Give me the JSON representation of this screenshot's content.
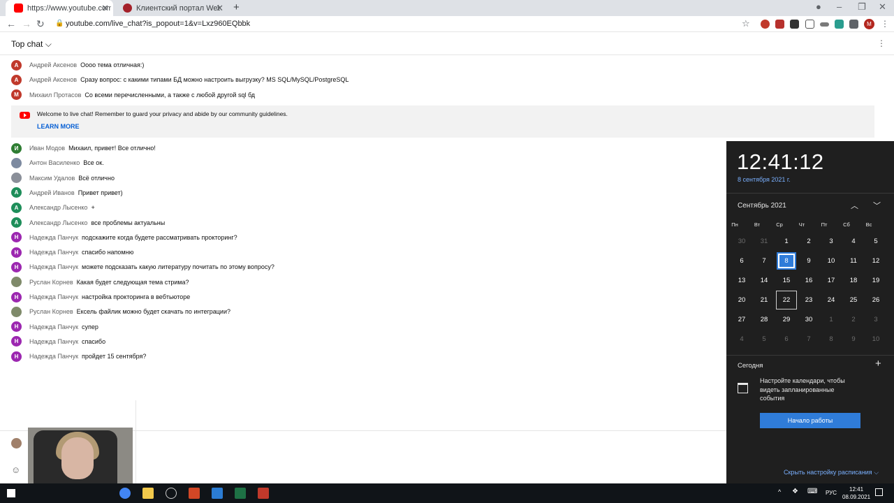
{
  "browser": {
    "tabs": [
      {
        "title": "https://www.youtube.com/live_ch",
        "active": true
      },
      {
        "title": "Клиентский портал WebSoft",
        "active": false
      }
    ],
    "url": "youtube.com/live_chat?is_popout=1&v=Lxz960EQbbk"
  },
  "chat": {
    "header": "Top chat",
    "messages_top": [
      {
        "initial": "А",
        "color": "#c0392b",
        "author": "Андрей Аксенов",
        "text": "Оооо тема отличная:)"
      },
      {
        "initial": "А",
        "color": "#c0392b",
        "author": "Андрей Аксенов",
        "text": "Сразу вопрос: с какими типами БД можно настроить выгрузку? MS SQL/MySQL/PostgreSQL"
      },
      {
        "initial": "М",
        "color": "#c0392b",
        "author": "Михаил Протасов",
        "text": "Со всеми перечисленными, а также с любой другой sql бд"
      }
    ],
    "notice": {
      "text": "Welcome to live chat! Remember to guard your privacy and abide by our community guidelines.",
      "link": "LEARN MORE"
    },
    "messages": [
      {
        "initial": "И",
        "color": "#2e7d32",
        "author": "Иван Модов",
        "text": "Михаил, привет! Все отлично!"
      },
      {
        "initial": "",
        "color": "#7d8aa0",
        "author": "Антон Василенко",
        "text": "Все ок."
      },
      {
        "initial": "",
        "color": "#8a8f99",
        "author": "Максим Удалов",
        "text": "Всё отлично"
      },
      {
        "initial": "А",
        "color": "#1e8e5a",
        "author": "Андрей Иванов",
        "text": "Привет привет)"
      },
      {
        "initial": "А",
        "color": "#1e8e5a",
        "author": "Александр Лысенко",
        "text": "+"
      },
      {
        "initial": "А",
        "color": "#1e8e5a",
        "author": "Александр Лысенко",
        "text": "все проблемы актуальны"
      },
      {
        "initial": "Н",
        "color": "#9c27b0",
        "author": "Надежда Панчук",
        "text": "подскажите когда будете рассматривать прокторинг?"
      },
      {
        "initial": "Н",
        "color": "#9c27b0",
        "author": "Надежда Панчук",
        "text": "спасибо напомню"
      },
      {
        "initial": "Н",
        "color": "#9c27b0",
        "author": "Надежда Панчук",
        "text": "можете подсказать какую литературу почитать по этому вопросу?"
      },
      {
        "initial": "",
        "color": "#7f8a6a",
        "author": "Руслан Корнев",
        "text": "Какая будет следующая тема стрима?"
      },
      {
        "initial": "Н",
        "color": "#9c27b0",
        "author": "Надежда Панчук",
        "text": "настройка прокторинга в вебтьюторе"
      },
      {
        "initial": "",
        "color": "#7f8a6a",
        "author": "Руслан Корнев",
        "text": "Ексель файлик можно будет скачать по интеграции?"
      },
      {
        "initial": "Н",
        "color": "#9c27b0",
        "author": "Надежда Панчук",
        "text": "супер"
      },
      {
        "initial": "Н",
        "color": "#9c27b0",
        "author": "Надежда Панчук",
        "text": "спасибо"
      },
      {
        "initial": "Н",
        "color": "#9c27b0",
        "author": "Надежда Панчук",
        "text": "пройдет 15 сентября?"
      }
    ]
  },
  "calendar": {
    "time": "12:41:12",
    "date": "8 сентября 2021 г.",
    "month": "Сентябрь 2021",
    "weekdays": [
      "Пн",
      "Вт",
      "Ср",
      "Чт",
      "Пт",
      "Сб",
      "Вс"
    ],
    "weeks": [
      [
        "30",
        "31",
        "1",
        "2",
        "3",
        "4",
        "5"
      ],
      [
        "6",
        "7",
        "8",
        "9",
        "10",
        "11",
        "12"
      ],
      [
        "13",
        "14",
        "15",
        "16",
        "17",
        "18",
        "19"
      ],
      [
        "20",
        "21",
        "22",
        "23",
        "24",
        "25",
        "26"
      ],
      [
        "27",
        "28",
        "29",
        "30",
        "1",
        "2",
        "3"
      ],
      [
        "4",
        "5",
        "6",
        "7",
        "8",
        "9",
        "10"
      ]
    ],
    "today_header": "Сегодня",
    "empty_text": "Настройте календари, чтобы видеть запланированные события",
    "start_button": "Начало работы",
    "hide_link": "Скрыть настройку расписания"
  },
  "taskbar": {
    "lang": "РУС",
    "clock_time": "12:41",
    "clock_date": "08.09.2021"
  }
}
